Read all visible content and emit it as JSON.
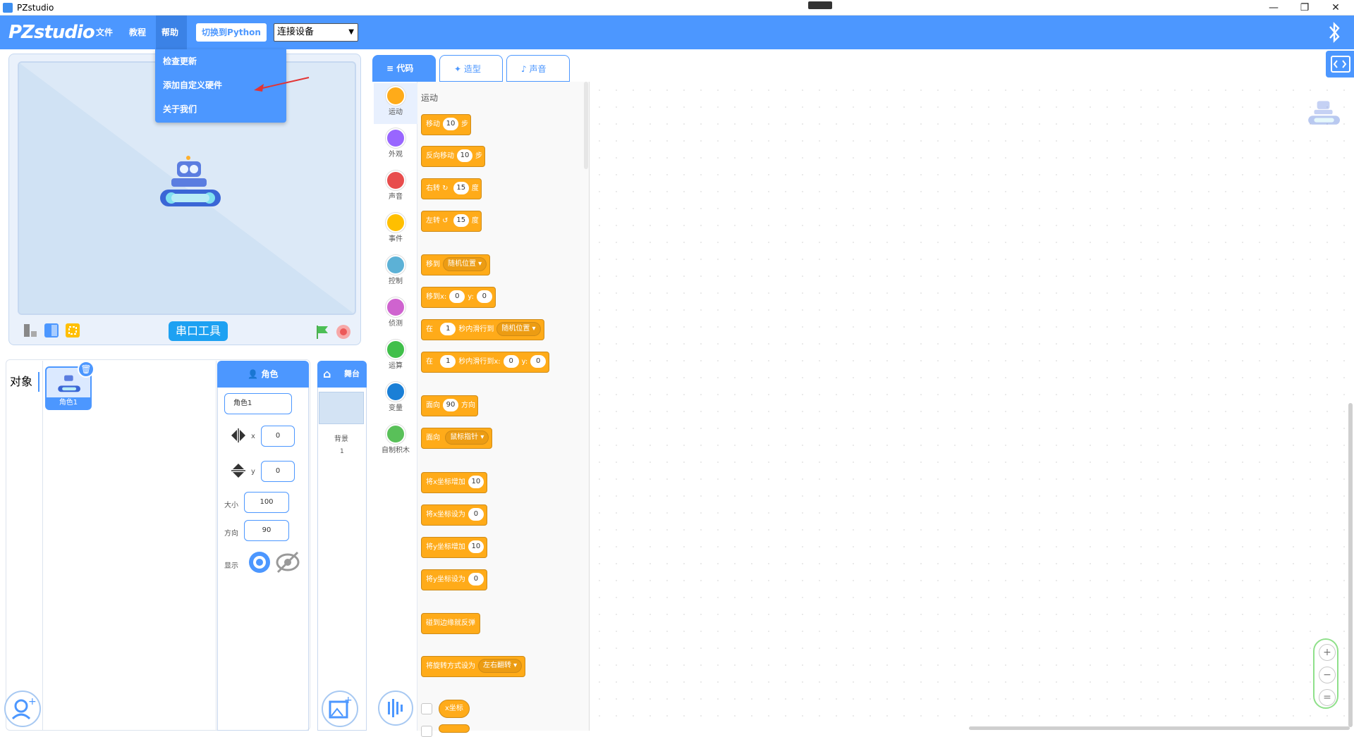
{
  "window": {
    "title": "PZstudio"
  },
  "menubar": {
    "logo": "PZstudio",
    "items": [
      "文件",
      "教程",
      "帮助"
    ],
    "python_button": "切换到Python",
    "device_select": "连接设备"
  },
  "help_menu": {
    "items": [
      "检查更新",
      "添加自定义硬件",
      "关于我们"
    ]
  },
  "stage": {
    "serial_button": "串口工具"
  },
  "objects": {
    "label": "对象",
    "sprite_name": "角色1",
    "role_tab": "角色",
    "stage_tab": "舞台",
    "name_value": "角色1",
    "x_label": "x",
    "x_value": "0",
    "y_label": "y",
    "y_value": "0",
    "size_label": "大小",
    "size_value": "100",
    "direction_label": "方向",
    "direction_value": "90",
    "show_label": "显示",
    "backdrop_label": "背景",
    "backdrop_count": "1"
  },
  "tabs": {
    "code": "代码",
    "costume": "造型",
    "sound": "声音"
  },
  "categories": [
    {
      "label": "运动",
      "color": "#ffab19"
    },
    {
      "label": "外观",
      "color": "#9966ff"
    },
    {
      "label": "声音",
      "color": "#e84d4d"
    },
    {
      "label": "事件",
      "color": "#ffbf00"
    },
    {
      "label": "控制",
      "color": "#5cb1d6"
    },
    {
      "label": "侦测",
      "color": "#cf63cf"
    },
    {
      "label": "运算",
      "color": "#40bf4a"
    },
    {
      "label": "变量",
      "color": "#1a7fd6"
    },
    {
      "label": "自制积木",
      "color": "#59c059"
    }
  ],
  "palette": {
    "title": "运动",
    "move": {
      "a": "移动",
      "n": "10",
      "b": "步"
    },
    "reverse": {
      "a": "反向移动",
      "n": "10",
      "b": "步"
    },
    "turn_right": {
      "a": "右转",
      "n": "15",
      "b": "度"
    },
    "turn_left": {
      "a": "左转",
      "n": "15",
      "b": "度"
    },
    "goto": {
      "a": "移到",
      "opt": "随机位置"
    },
    "goto_xy": {
      "a": "移到x:",
      "x": "0",
      "b": "y:",
      "y": "0"
    },
    "glide": {
      "a": "在",
      "n": "1",
      "b": "秒内滑行到",
      "opt": "随机位置"
    },
    "glide_xy": {
      "a": "在",
      "n": "1",
      "b": "秒内滑行到x:",
      "x": "0",
      "c": "y:",
      "y": "0"
    },
    "point_dir": {
      "a": "面向",
      "n": "90",
      "b": "方向"
    },
    "point_to": {
      "a": "面向",
      "opt": "鼠标指针"
    },
    "change_x": {
      "a": "将x坐标增加",
      "n": "10"
    },
    "set_x": {
      "a": "将x坐标设为",
      "n": "0"
    },
    "change_y": {
      "a": "将y坐标增加",
      "n": "10"
    },
    "set_y": {
      "a": "将y坐标设为",
      "n": "0"
    },
    "bounce": "碰到边缘就反弹",
    "rotation": {
      "a": "将旋转方式设为",
      "opt": "左右翻转"
    },
    "xpos": "x坐标"
  }
}
